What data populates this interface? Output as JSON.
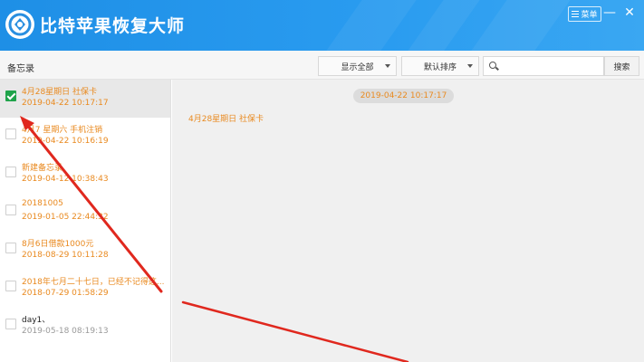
{
  "app": {
    "title": "比特苹果恢复大师",
    "menu_label": "菜单",
    "minimize": "—",
    "close": "✕"
  },
  "toolbar": {
    "section": "备忘录",
    "filter": "显示全部",
    "sort": "默认排序",
    "search_placeholder": "",
    "search_button": "搜索"
  },
  "notes": [
    {
      "title": "4月28星期日 社保卡",
      "date": "2019-04-22 10:17:17",
      "checked": true,
      "deleted": true
    },
    {
      "title": "4月7 星期六 手机注销",
      "date": "2019-04-22 10:16:19",
      "checked": false,
      "deleted": true
    },
    {
      "title": "新建备忘录",
      "date": "2019-04-12 10:38:43",
      "checked": false,
      "deleted": true
    },
    {
      "title": "20181005",
      "date": "2019-01-05 22:44:32",
      "checked": false,
      "deleted": true
    },
    {
      "title": "8月6日借款1000元",
      "date": "2018-08-29 10:11:28",
      "checked": false,
      "deleted": true
    },
    {
      "title": "2018年七月二十七日，已经不记得这...",
      "date": "2018-07-29 01:58:29",
      "checked": false,
      "deleted": true
    },
    {
      "title": "day1、",
      "date": "2019-05-18 08:19:13",
      "checked": false,
      "deleted": false
    }
  ],
  "detail": {
    "date": "2019-04-22 10:17:17",
    "content": "4月28星期日 社保卡"
  },
  "colors": {
    "accent": "#1e8fe6",
    "deleted_text": "#e98a20",
    "check": "#1fa34a",
    "arrow": "#e0281e"
  }
}
